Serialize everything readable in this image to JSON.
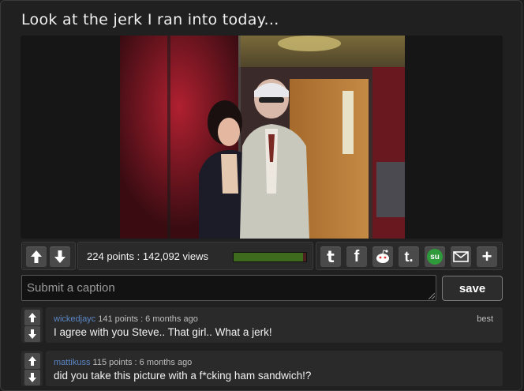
{
  "post": {
    "title": "Look at the jerk I ran into today..."
  },
  "stats": {
    "points": "224",
    "points_label": "points",
    "separator": ":",
    "views": "142,092",
    "views_label": "views",
    "vote_ratio": 0.96
  },
  "share_icons": [
    "tumblr-icon",
    "facebook-icon",
    "reddit-icon",
    "tumblr-t-icon",
    "stumbleupon-icon",
    "email-icon",
    "more-plus-icon"
  ],
  "share_labels": {
    "tumblr": "t",
    "facebook": "f",
    "tumblr_t": "t.",
    "stumbleupon": "su",
    "more": "+"
  },
  "caption": {
    "placeholder": "Submit a caption",
    "save_label": "save"
  },
  "comments": [
    {
      "user": "wickedjayc",
      "meta": "141 points : 6 months ago",
      "text": "I agree with you Steve.. That girl.. What a jerk!",
      "badge": "best"
    },
    {
      "user": "mattikuss",
      "meta": "115 points : 6 months ago",
      "text": "did you take this picture with a f*cking ham sandwich!?",
      "badge": ""
    }
  ],
  "colors": {
    "accent_link": "#5b86c6",
    "progress_good": "#3d6a1c",
    "progress_bad": "#4a2020"
  }
}
